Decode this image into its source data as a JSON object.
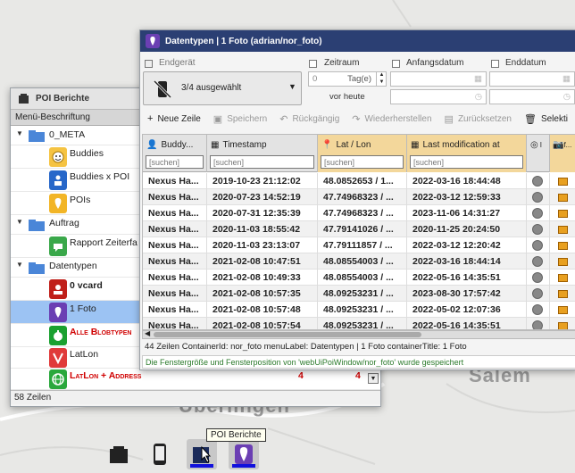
{
  "map": {
    "labels": [
      "Salem",
      "Überlingen"
    ]
  },
  "poi_window": {
    "title": "POI Berichte",
    "column_header": "Menü-Beschriftung",
    "items": [
      {
        "label": "0_META",
        "type": "folder"
      },
      {
        "label": "Buddies",
        "type": "item"
      },
      {
        "label": "Buddies x POI",
        "type": "item"
      },
      {
        "label": "POIs",
        "type": "item"
      },
      {
        "label": "Auftrag",
        "type": "folder"
      },
      {
        "label": "Rapport Zeiterfa",
        "type": "item"
      },
      {
        "label": "Datentypen",
        "type": "folder"
      },
      {
        "label": "0 vcard",
        "type": "item"
      },
      {
        "label": "1 Foto",
        "type": "item"
      },
      {
        "label": "Alle Blobtypen",
        "type": "item"
      },
      {
        "label": "LatLon",
        "type": "item"
      },
      {
        "label": "LatLon + Address",
        "type": "item"
      }
    ],
    "counts": [
      "4",
      "4"
    ],
    "footer": "58 Zeilen"
  },
  "dt_window": {
    "title": "Datentypen | 1 Foto (adrian/nor_foto)",
    "filters": {
      "endgeraet": "Endgerät",
      "zeitraum": "Zeitraum",
      "anfangsdatum": "Anfangsdatum",
      "enddatum": "Enddatum",
      "selection": "3/4 ausgewählt",
      "days_value": "0",
      "days_unit": "Tag(e)",
      "before_today": "vor heute"
    },
    "toolbar": {
      "new_row": "Neue Zeile",
      "save": "Speichern",
      "undo": "Rückgängig",
      "redo": "Wiederherstellen",
      "reset": "Zurücksetzen",
      "select": "Selekti"
    },
    "columns": [
      {
        "label": "Buddy...",
        "search": "[suchen]"
      },
      {
        "label": "Timestamp",
        "search": "[suchen]"
      },
      {
        "label": "Lat / Lon",
        "search": "[suchen]"
      },
      {
        "label": "Last modification at",
        "search": "[suchen]"
      },
      {
        "label": "I",
        "search": ""
      },
      {
        "label": "f...",
        "search": ""
      }
    ],
    "rows": [
      [
        "Nexus Ha...",
        "2019-10-23 21:12:02",
        "48.0852653 / 1...",
        "2022-03-16 18:44:48"
      ],
      [
        "Nexus Ha...",
        "2020-07-23 14:52:19",
        "47.74968323 / ...",
        "2022-03-12 12:59:33"
      ],
      [
        "Nexus Ha...",
        "2020-07-31 12:35:39",
        "47.74968323 / ...",
        "2023-11-06 14:31:27"
      ],
      [
        "Nexus Ha...",
        "2020-11-03 18:55:42",
        "47.79141026 / ...",
        "2020-11-25 20:24:50"
      ],
      [
        "Nexus Ha...",
        "2020-11-03 23:13:07",
        "47.79111857 / ...",
        "2022-03-12 12:20:42"
      ],
      [
        "Nexus Ha...",
        "2021-02-08 10:47:51",
        "48.08554003 / ...",
        "2022-03-16 18:44:14"
      ],
      [
        "Nexus Ha...",
        "2021-02-08 10:49:33",
        "48.08554003 / ...",
        "2022-05-16 14:35:51"
      ],
      [
        "Nexus Ha...",
        "2021-02-08 10:57:35",
        "48.09253231 / ...",
        "2023-08-30 17:57:42"
      ],
      [
        "Nexus Ha...",
        "2021-02-08 10:57:48",
        "48.09253231 / ...",
        "2022-05-02 12:07:36"
      ],
      [
        "Nexus Ha...",
        "2021-02-08 10:57:54",
        "48.09253231 / ...",
        "2022-05-16 14:35:51"
      ]
    ],
    "status": "44 Zeilen ContainerId: nor_foto menuLabel: Datentypen | 1 Foto containerTitle: 1 Foto",
    "message": "Die Fenstergröße und Fensterposition von 'webUiPoiWindow/nor_foto' wurde gespeichert"
  },
  "dock": {
    "tooltip": "POI Berichte"
  },
  "colors": {
    "titlebar": "#2b3f73",
    "selected": "#9cc3f3",
    "sorted_col": "#f3d79b",
    "red_text": "#d00000",
    "dock_active": "#1111dd"
  }
}
